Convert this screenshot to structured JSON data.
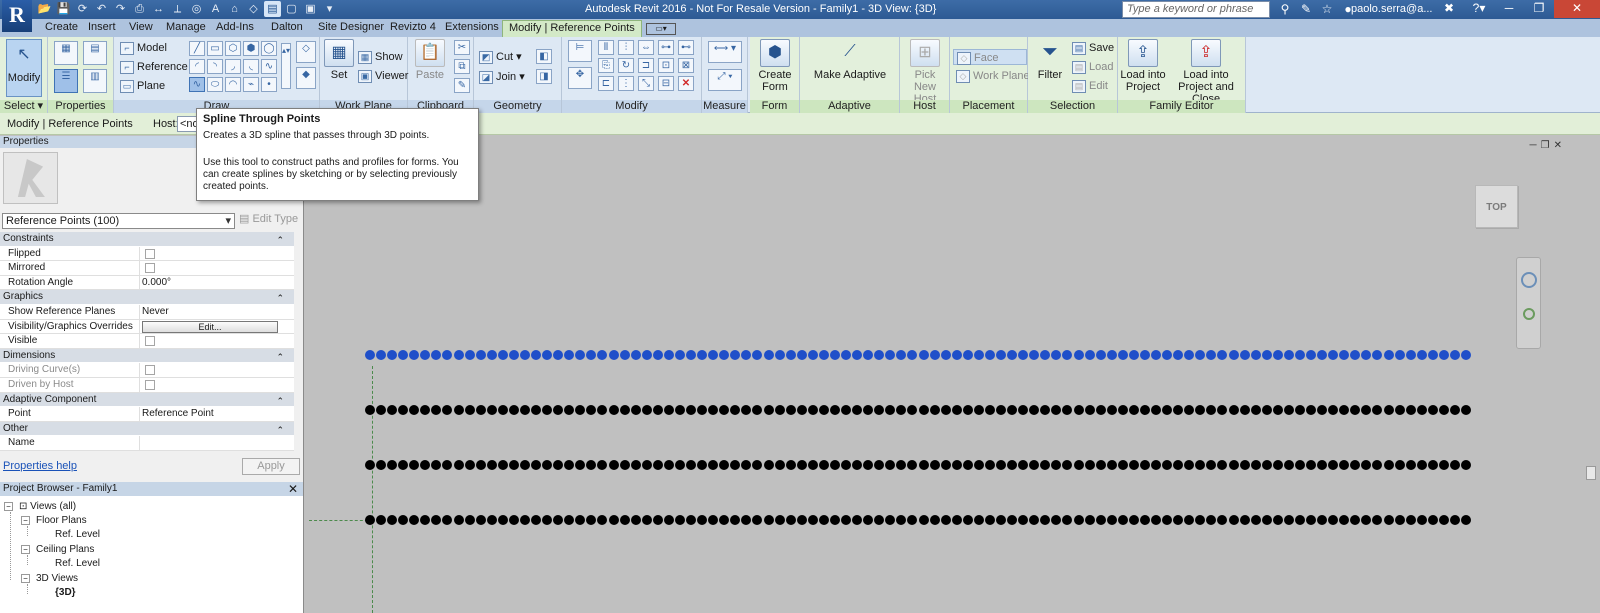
{
  "app": {
    "logo_letter": "R",
    "title": "Autodesk Revit 2016 -  Not For Resale Version -     Family1 - 3D View: {3D}",
    "search_placeholder": "Type a keyword or phrase",
    "user": "paolo.serra@a...",
    "accent_color": "#2d5a94"
  },
  "tabs": [
    "Create",
    "Insert",
    "View",
    "Manage",
    "Add-Ins",
    "Dalton",
    "Site Designer",
    "Revizto 4",
    "Extensions",
    "Modify | Reference Points"
  ],
  "ribbon": {
    "select": {
      "button": "Modify",
      "label": "Select"
    },
    "properties": {
      "label": "Properties"
    },
    "draw": {
      "items": [
        "Model",
        "Reference",
        "Plane"
      ],
      "label": "Draw"
    },
    "work_plane": {
      "set": "Set",
      "show": "Show",
      "viewer": "Viewer",
      "label": "Work Plane"
    },
    "clipboard": {
      "paste": "Paste",
      "label": "Clipboard"
    },
    "geometry": {
      "cut": "Cut",
      "join": "Join",
      "label": "Geometry"
    },
    "modify": {
      "label": "Modify"
    },
    "measure": {
      "label": "Measure"
    },
    "form": {
      "create_form": "Create\nForm",
      "label": "Form"
    },
    "adaptive": {
      "make": "Make Adaptive",
      "label": "Adaptive Component"
    },
    "host": {
      "pick": "Pick\nNew Host",
      "label": "Host"
    },
    "placement": {
      "face": "Face",
      "work_plane": "Work Plane",
      "label": "Placement"
    },
    "selection": {
      "filter": "Filter",
      "label": "Selection"
    },
    "family_editor": {
      "save": "Save",
      "load": "Load",
      "edit": "Edit",
      "load_into_project": "Load into\nProject",
      "load_close": "Load into\nProject and Close",
      "label": "Family Editor"
    }
  },
  "options_bar": {
    "context": "Modify | Reference Points",
    "host_label": "Host:",
    "host_value": "<no"
  },
  "tooltip": {
    "title": "Spline Through Points",
    "subtitle": "Creates a 3D spline that passes through 3D points.",
    "body": "Use this tool to construct paths and profiles for forms. You can create splines by sketching or by selecting previously created points."
  },
  "properties": {
    "header": "Properties",
    "type_selector": "Reference Points (100)",
    "edit_type": "Edit Type",
    "groups": [
      {
        "name": "Constraints",
        "rows": [
          {
            "name": "Flipped",
            "value": "",
            "kind": "check",
            "disabled": false
          },
          {
            "name": "Mirrored",
            "value": "",
            "kind": "check",
            "disabled": false
          },
          {
            "name": "Rotation Angle",
            "value": "0.000°",
            "kind": "text",
            "disabled": false
          }
        ]
      },
      {
        "name": "Graphics",
        "rows": [
          {
            "name": "Show Reference Planes",
            "value": "Never",
            "kind": "text",
            "disabled": false
          },
          {
            "name": "Visibility/Graphics Overrides",
            "value": "Edit...",
            "kind": "button",
            "disabled": false
          },
          {
            "name": "Visible",
            "value": "",
            "kind": "check",
            "disabled": false
          }
        ]
      },
      {
        "name": "Dimensions",
        "rows": [
          {
            "name": "Driving Curve(s)",
            "value": "",
            "kind": "check",
            "disabled": true
          },
          {
            "name": "Driven by Host",
            "value": "",
            "kind": "check",
            "disabled": true
          }
        ]
      },
      {
        "name": "Adaptive Component",
        "rows": [
          {
            "name": "Point",
            "value": "Reference Point",
            "kind": "text",
            "disabled": false
          }
        ]
      },
      {
        "name": "Other",
        "rows": [
          {
            "name": "Name",
            "value": "",
            "kind": "text",
            "disabled": false
          }
        ]
      }
    ],
    "help_link": "Properties help",
    "apply": "Apply"
  },
  "project_browser": {
    "header": "Project Browser - Family1",
    "items": [
      "Views (all)",
      "Floor Plans",
      "Ref. Level",
      "Ceiling Plans",
      "Ref. Level",
      "3D Views",
      "{3D}"
    ]
  },
  "view": {
    "viewcube_label": "TOP",
    "point_rows": 4,
    "points_per_row": 100,
    "selected_row": 0,
    "selected_color": "#1f4fc9",
    "point_color": "#000000"
  }
}
